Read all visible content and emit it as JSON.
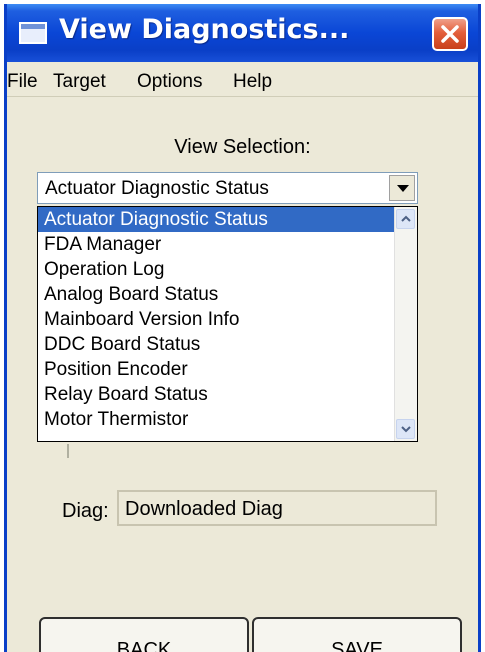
{
  "window": {
    "title": "View Diagnostics...",
    "accent": "#0a46d6"
  },
  "menu": {
    "items": [
      "File",
      "Target",
      "Options",
      "Help"
    ]
  },
  "view_selection": {
    "label": "View Selection:",
    "selected": "Actuator Diagnostic Status",
    "options": [
      "Actuator Diagnostic Status",
      "FDA Manager",
      "Operation Log",
      "Analog Board Status",
      "Mainboard Version Info",
      "DDC Board Status",
      "Position Encoder",
      "Relay Board Status",
      "Motor Thermistor"
    ],
    "highlighted_index": 0,
    "highlight_color": "#316ac5"
  },
  "diag": {
    "label": "Diag:",
    "value": "Downloaded Diag"
  },
  "buttons": {
    "back": "BACK",
    "save": "SAVE"
  },
  "icons": {
    "window_icon": "window-icon",
    "close": "close-icon",
    "dropdown_arrow": "chevron-down-icon"
  }
}
